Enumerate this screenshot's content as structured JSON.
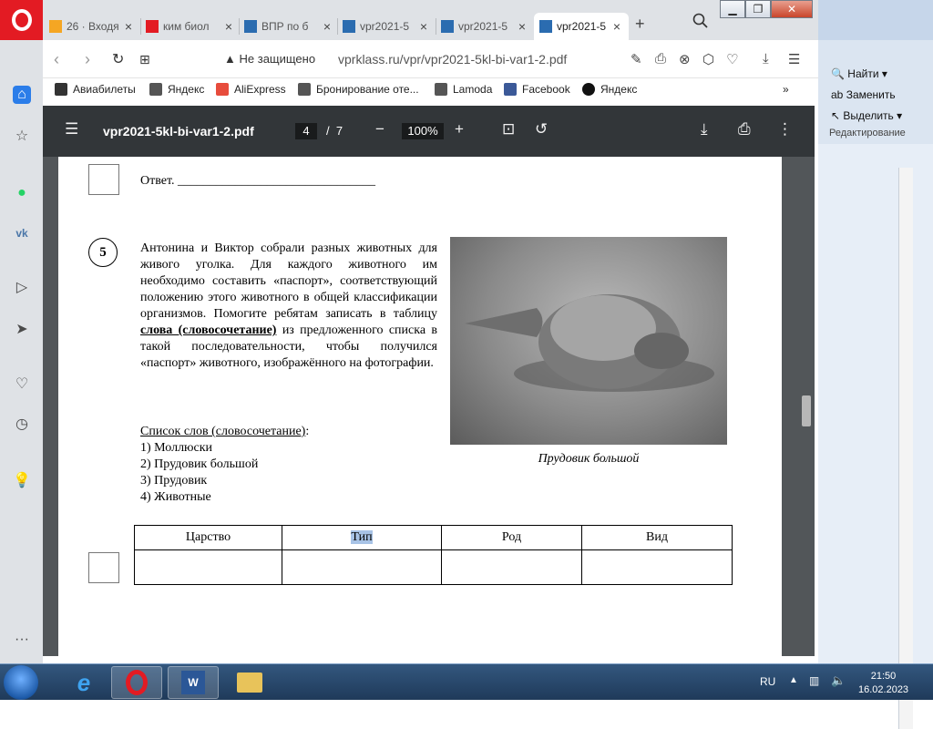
{
  "browser": {
    "tabs": [
      {
        "label": "26 · Входя",
        "color": "#f5a623"
      },
      {
        "label": "ким биол",
        "color": "#e31b23"
      },
      {
        "label": "ВПР по б",
        "color": "#2b6cb0"
      },
      {
        "label": "vpr2021-5",
        "color": "#2b6cb0"
      },
      {
        "label": "vpr2021-5",
        "color": "#2b6cb0"
      },
      {
        "label": "vpr2021-5",
        "color": "#2b6cb0"
      }
    ],
    "new_tab": "+",
    "security": "Не защищено",
    "url": "vprklass.ru/vpr/vpr2021-5kl-bi-var1-2.pdf",
    "bookmarks": [
      "Авиабилеты",
      "Яндекс",
      "AliExpress",
      "Бронирование оте...",
      "Lamoda",
      "Facebook",
      "Яндекс"
    ],
    "bookmarks_more": "»"
  },
  "pdf": {
    "filename": "vpr2021-5kl-bi-var1-2.pdf",
    "page_current": "4",
    "page_sep": "/",
    "page_total": "7",
    "zoom": "100%",
    "answer_label": "Ответ. _______________________________",
    "question_number": "5",
    "question_part1": "Антонина и Виктор собрали разных животных для живого уголка. Для каждого животного им необходимо составить «паспорт», соответствующий положению этого животного в общей классификации организмов. Помогите ребятам записать в таблицу",
    "question_bold": "слова (словосочетание)",
    "question_part2": "из предложенного списка в такой последовательности, чтобы получился «паспорт» животного, изображённого на фотографии.",
    "list_title": "Список слов (словосочетание)",
    "list_colon": ":",
    "list_items": [
      "1) Моллюски",
      "2) Прудовик большой",
      "3) Прудовик",
      "4) Животные"
    ],
    "photo_caption": "Прудовик большой",
    "table_headers": [
      "Царство",
      "Тип",
      "Род",
      "Вид"
    ]
  },
  "word": {
    "find": "Найти",
    "replace": "Заменить",
    "select": "Выделить",
    "group": "Редактирование"
  },
  "taskbar": {
    "lang": "RU",
    "time": "21:50",
    "date": "16.02.2023"
  }
}
